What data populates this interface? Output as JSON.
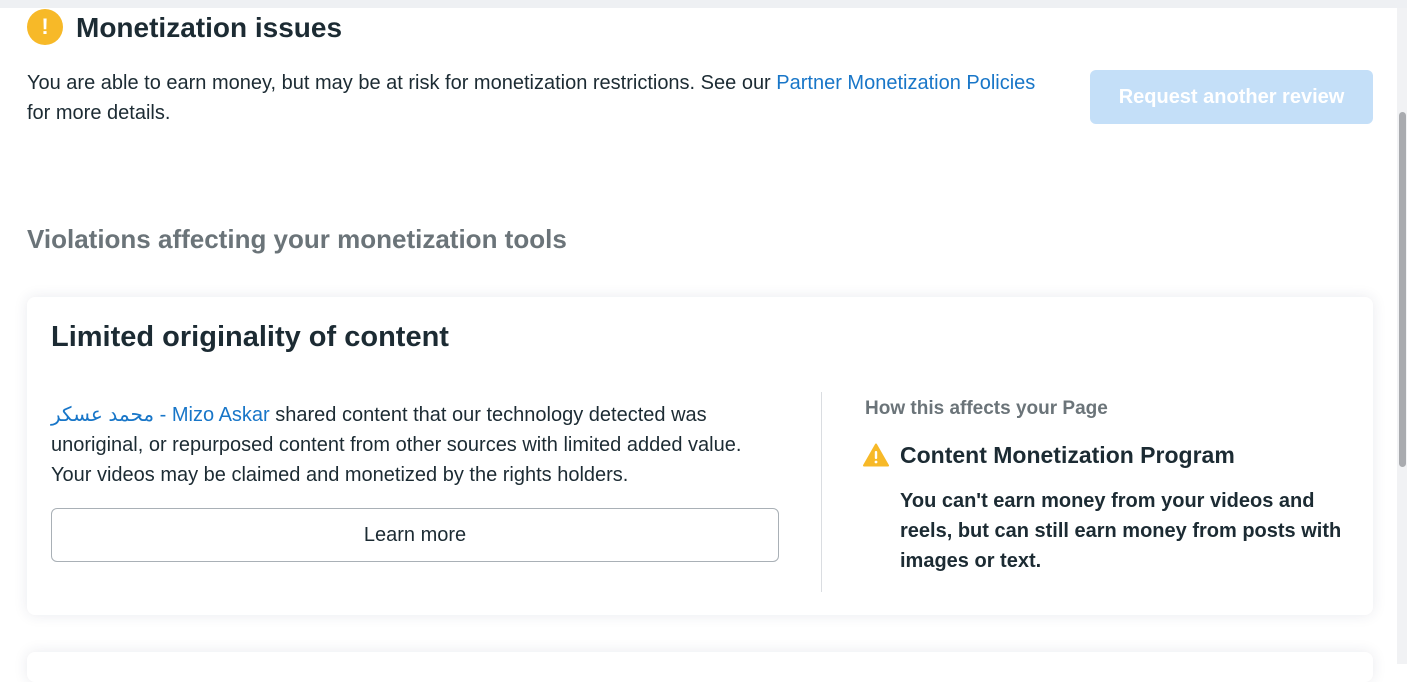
{
  "header": {
    "title": "Monetization issues",
    "intro_text": "You are able to earn money, but may be at risk for monetization restrictions. See our ",
    "policy_link": "Partner Monetization Policies",
    "intro_suffix": " for more details.",
    "review_button": "Request another review"
  },
  "section": {
    "heading": "Violations affecting your monetization tools"
  },
  "violation_card": {
    "title": "Limited originality of content",
    "page_link": "محمد عسكر - Mizo Askar",
    "description": " shared content that our technology detected was unoriginal, or repurposed content from other sources with limited added value. Your videos may be claimed and monetized by the rights holders.",
    "learn_more": "Learn more",
    "affects_label": "How this affects your Page",
    "program_title": "Content Monetization Program",
    "program_description": "You can't earn money from your videos and reels, but can still earn money from posts with images or text."
  },
  "colors": {
    "warning": "#f7b928",
    "link": "#1876c8",
    "disabled_button": "#c4dff8"
  },
  "icons": {
    "header_icon": "exclamation-circle-icon",
    "program_icon": "warning-triangle-icon"
  }
}
